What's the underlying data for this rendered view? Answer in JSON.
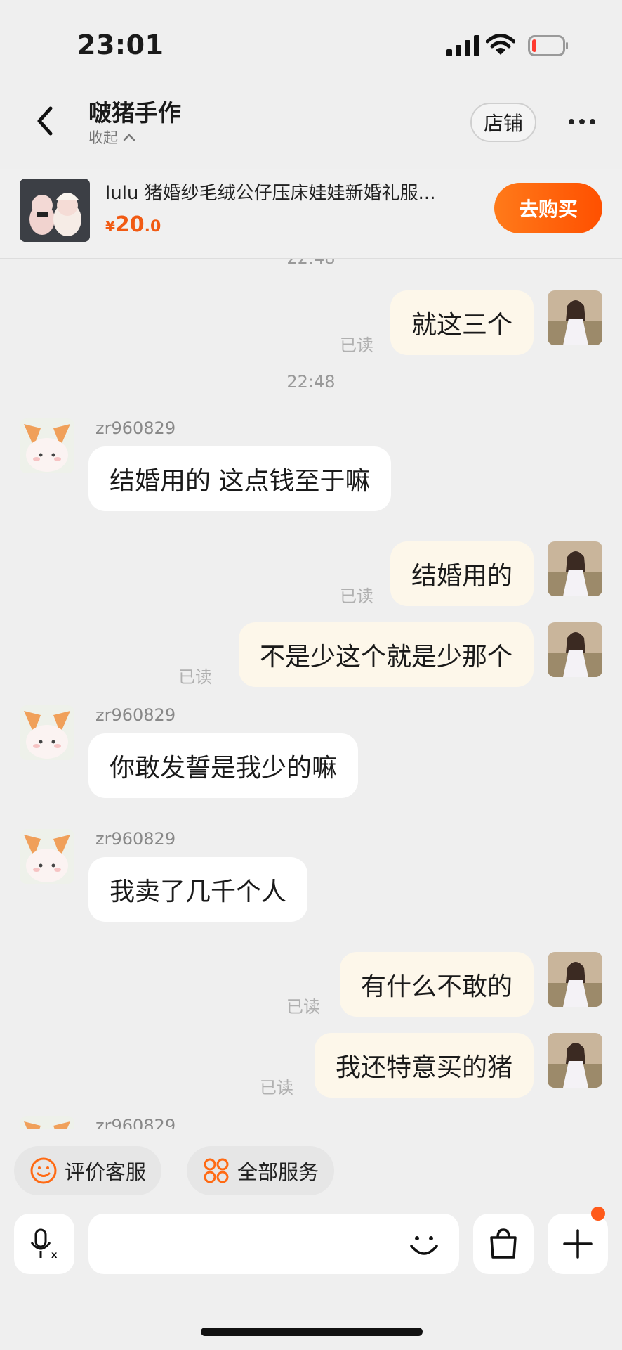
{
  "status_bar": {
    "time": "23:01"
  },
  "header": {
    "shop_name": "啵猪手作",
    "collapse_label": "收起",
    "store_button": "店铺"
  },
  "product": {
    "title": "lulu 猪婚纱毛绒公仔压床娃娃新婚礼服...",
    "price_symbol": "¥",
    "price_int": "20",
    "price_dec": ".0",
    "buy_button": "去购买"
  },
  "chat": {
    "partial_timestamp": "22:48",
    "timestamp": "22:48",
    "read_label": "已读",
    "messages": [
      {
        "side": "out",
        "text": "就这三个",
        "read": "已读"
      },
      {
        "side": "in",
        "user": "zr960829",
        "text": "结婚用的 这点钱至于嘛"
      },
      {
        "side": "out",
        "text": "结婚用的",
        "read": "已读"
      },
      {
        "side": "out",
        "text": "不是少这个就是少那个",
        "read": "已读"
      },
      {
        "side": "in",
        "user": "zr960829",
        "text": "你敢发誓是我少的嘛"
      },
      {
        "side": "in",
        "user": "zr960829",
        "text": "我卖了几千个人"
      },
      {
        "side": "out",
        "text": "有什么不敢的",
        "read": "已读"
      },
      {
        "side": "out",
        "text": "我还特意买的猪",
        "read": "已读"
      },
      {
        "side": "in",
        "user": "zr960829",
        "text": ""
      }
    ]
  },
  "quick_actions": {
    "rate_service": "评价客服",
    "all_services": "全部服务"
  },
  "input": {
    "placeholder": ""
  },
  "icons": {
    "back": "chevron-left-icon",
    "more": "more-dots-icon",
    "voice": "mic-translate-icon",
    "emoji": "smile-icon",
    "bag": "shopping-bag-icon",
    "plus": "plus-icon",
    "rate": "smile-circle-icon",
    "services": "grid-services-icon"
  },
  "colors": {
    "accent": "#ff5000",
    "price": "#f15a13",
    "outgoing_bubble": "#fdf7ea",
    "incoming_bubble": "#ffffff",
    "background": "#efefef"
  }
}
